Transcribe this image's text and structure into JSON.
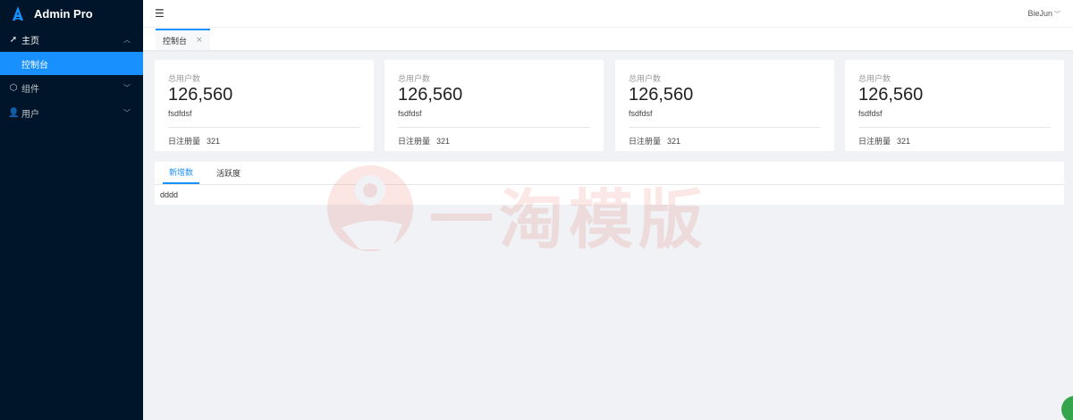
{
  "app": {
    "title": "Admin Pro"
  },
  "colors": {
    "sidebar_bg": "#001529",
    "accent": "#1890ff",
    "page_bg": "#f0f2f5"
  },
  "sidebar": {
    "items": [
      {
        "label": "主页",
        "icon": "send-icon",
        "expanded": true,
        "children": [
          {
            "label": "控制台",
            "active": true
          }
        ]
      },
      {
        "label": "组件",
        "icon": "cube-icon",
        "expanded": false
      },
      {
        "label": "用户",
        "icon": "user-icon",
        "expanded": false
      }
    ]
  },
  "header": {
    "user_name": "BieJun"
  },
  "tabs": [
    {
      "label": "控制台",
      "close": "×"
    }
  ],
  "cards": [
    {
      "label": "总用户数",
      "value": "126,560",
      "sub": "fsdfdsf",
      "footer_label": "日注册量",
      "footer_value": "321"
    },
    {
      "label": "总用户数",
      "value": "126,560",
      "sub": "fsdfdsf",
      "footer_label": "日注册量",
      "footer_value": "321"
    },
    {
      "label": "总用户数",
      "value": "126,560",
      "sub": "fsdfdsf",
      "footer_label": "日注册量",
      "footer_value": "321"
    },
    {
      "label": "总用户数",
      "value": "126,560",
      "sub": "fsdfdsf",
      "footer_label": "日注册量",
      "footer_value": "321"
    }
  ],
  "panel": {
    "tabs": [
      {
        "label": "新增数",
        "active": true
      },
      {
        "label": "活跃度",
        "active": false
      }
    ],
    "content": "dddd"
  },
  "watermark": {
    "text": "一淘模版"
  }
}
